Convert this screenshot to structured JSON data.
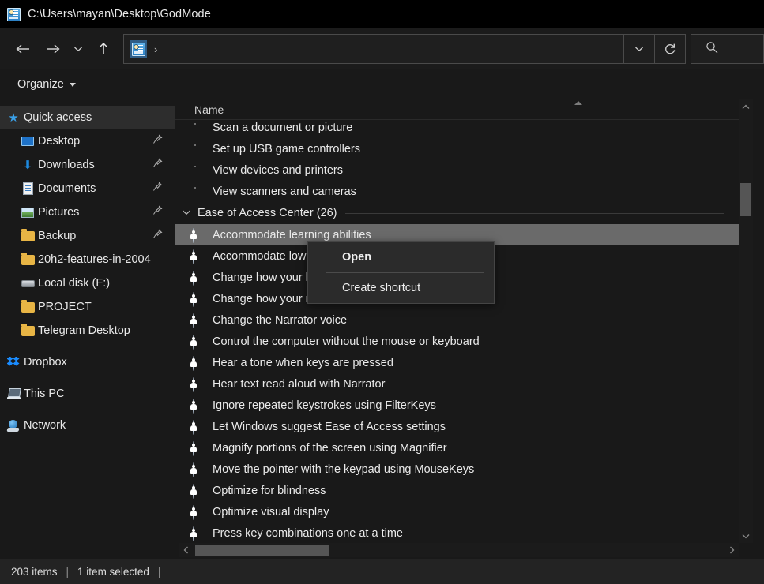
{
  "window": {
    "title": "C:\\Users\\mayan\\Desktop\\GodMode",
    "title_icon": "godmode-icon"
  },
  "nav": {
    "back_icon": "arrow-left-icon",
    "forward_icon": "arrow-right-icon",
    "recent_icon": "chevron-down-icon",
    "up_icon": "arrow-up-icon",
    "address_value": "",
    "address_icon": "godmode-icon",
    "address_chevron": "›",
    "dropdown_icon": "chevron-down-icon",
    "refresh_icon": "refresh-icon",
    "search_icon": "search-icon",
    "search_placeholder": ""
  },
  "toolbar": {
    "organize_label": "Organize"
  },
  "sidebar": {
    "items": [
      {
        "label": "Quick access",
        "icon": "star-icon",
        "selected": true,
        "pinned": false,
        "indent": false
      },
      {
        "label": "Desktop",
        "icon": "desktop-icon",
        "selected": false,
        "pinned": true,
        "indent": true
      },
      {
        "label": "Downloads",
        "icon": "download-icon",
        "selected": false,
        "pinned": true,
        "indent": true
      },
      {
        "label": "Documents",
        "icon": "document-icon",
        "selected": false,
        "pinned": true,
        "indent": true
      },
      {
        "label": "Pictures",
        "icon": "pictures-icon",
        "selected": false,
        "pinned": true,
        "indent": true
      },
      {
        "label": "Backup",
        "icon": "folder-icon",
        "selected": false,
        "pinned": true,
        "indent": true
      },
      {
        "label": "20h2-features-in-2004",
        "icon": "folder-icon",
        "selected": false,
        "pinned": false,
        "indent": true
      },
      {
        "label": "Local disk (F:)",
        "icon": "disk-icon",
        "selected": false,
        "pinned": false,
        "indent": true
      },
      {
        "label": "PROJECT",
        "icon": "folder-icon",
        "selected": false,
        "pinned": false,
        "indent": true
      },
      {
        "label": "Telegram Desktop",
        "icon": "folder-icon",
        "selected": false,
        "pinned": false,
        "indent": true
      },
      {
        "label": "Dropbox",
        "icon": "dropbox-icon",
        "selected": false,
        "pinned": false,
        "indent": false
      },
      {
        "label": "This PC",
        "icon": "this-pc-icon",
        "selected": false,
        "pinned": false,
        "indent": false
      },
      {
        "label": "Network",
        "icon": "network-icon",
        "selected": false,
        "pinned": false,
        "indent": false
      }
    ],
    "pin_glyph": "📌"
  },
  "filelist": {
    "column_header": "Name",
    "sort_indicator": "ascending",
    "rows": [
      {
        "label": "Scan a document or picture",
        "icon": "control-panel-icon",
        "type": "item",
        "selected": false
      },
      {
        "label": "Set up USB game controllers",
        "icon": "control-panel-icon",
        "type": "item",
        "selected": false
      },
      {
        "label": "View devices and printers",
        "icon": "control-panel-icon",
        "type": "item",
        "selected": false
      },
      {
        "label": "View scanners and cameras",
        "icon": "control-panel-icon",
        "type": "item",
        "selected": false
      },
      {
        "label": "Ease of Access Center (26)",
        "icon": "chevron-down-icon",
        "type": "group",
        "selected": false
      },
      {
        "label": "Accommodate learning abilities",
        "icon": "ease-of-access-icon",
        "type": "item",
        "selected": true
      },
      {
        "label": "Accommodate low vision",
        "icon": "ease-of-access-icon",
        "type": "item",
        "selected": false
      },
      {
        "label": "Change how your keyboard works",
        "icon": "ease-of-access-icon",
        "type": "item",
        "selected": false
      },
      {
        "label": "Change how your mouse works",
        "icon": "ease-of-access-icon",
        "type": "item",
        "selected": false
      },
      {
        "label": "Change the Narrator voice",
        "icon": "ease-of-access-icon",
        "type": "item",
        "selected": false
      },
      {
        "label": "Control the computer without the mouse or keyboard",
        "icon": "ease-of-access-icon",
        "type": "item",
        "selected": false
      },
      {
        "label": "Hear a tone when keys are pressed",
        "icon": "ease-of-access-icon",
        "type": "item",
        "selected": false
      },
      {
        "label": "Hear text read aloud with Narrator",
        "icon": "ease-of-access-icon",
        "type": "item",
        "selected": false
      },
      {
        "label": "Ignore repeated keystrokes using FilterKeys",
        "icon": "ease-of-access-icon",
        "type": "item",
        "selected": false
      },
      {
        "label": "Let Windows suggest Ease of Access settings",
        "icon": "ease-of-access-icon",
        "type": "item",
        "selected": false
      },
      {
        "label": "Magnify portions of the screen using Magnifier",
        "icon": "ease-of-access-icon",
        "type": "item",
        "selected": false
      },
      {
        "label": "Move the pointer with the keypad using MouseKeys",
        "icon": "ease-of-access-icon",
        "type": "item",
        "selected": false
      },
      {
        "label": "Optimize for blindness",
        "icon": "ease-of-access-icon",
        "type": "item",
        "selected": false
      },
      {
        "label": "Optimize visual display",
        "icon": "ease-of-access-icon",
        "type": "item",
        "selected": false
      },
      {
        "label": "Press key combinations one at a time",
        "icon": "ease-of-access-icon",
        "type": "item",
        "selected": false
      }
    ]
  },
  "context_menu": {
    "items": [
      {
        "label": "Open",
        "bold": true
      },
      {
        "label": "Create shortcut",
        "bold": false
      }
    ]
  },
  "statusbar": {
    "item_count": "203 items",
    "selection": "1 item selected",
    "separator": "|"
  },
  "colors": {
    "background": "#191919",
    "titlebar": "#000000",
    "selection": "#6a6a6a",
    "sidebar_selected": "#2d2d2d",
    "accent_blue": "#1d8ae0",
    "text": "#eaeaea"
  }
}
